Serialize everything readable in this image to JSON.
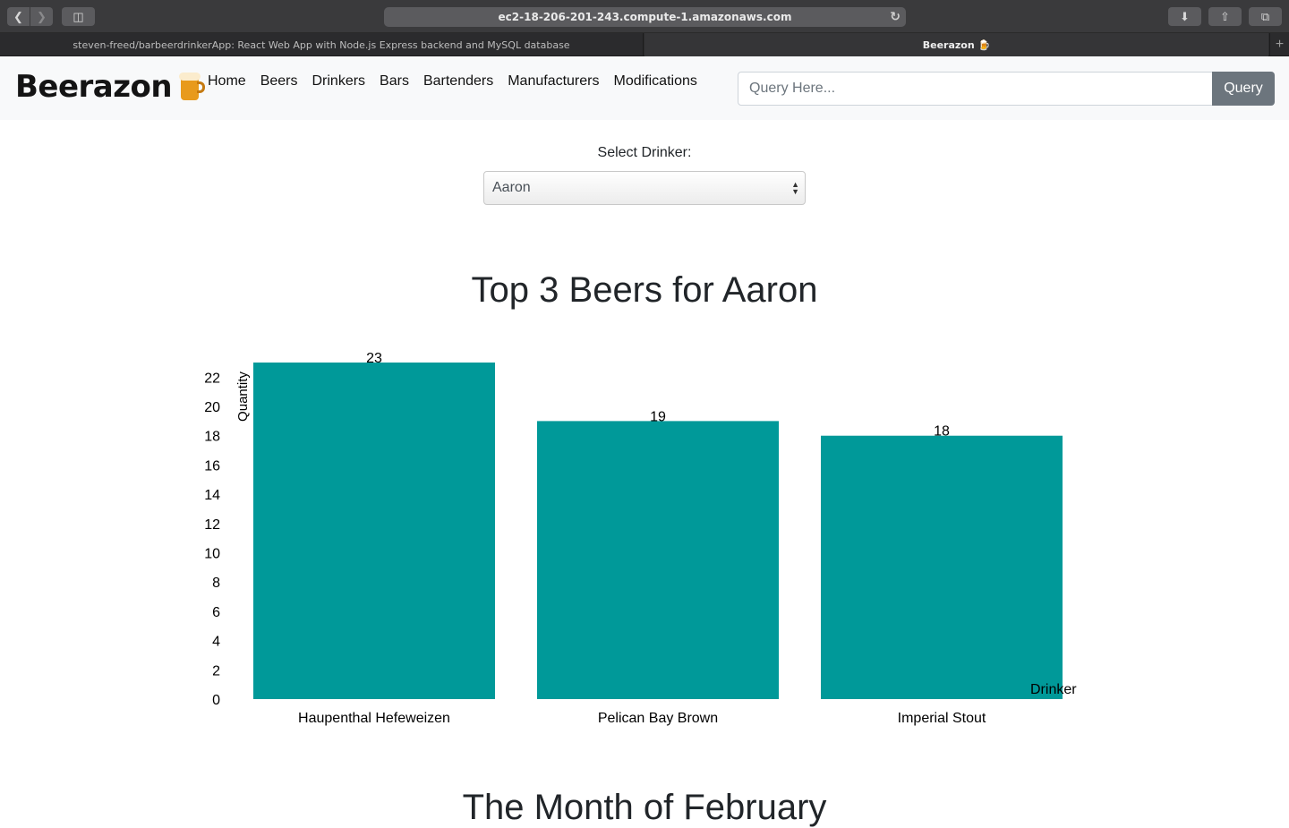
{
  "browser": {
    "url": "ec2-18-206-201-243.compute-1.amazonaws.com",
    "tabs": [
      {
        "label": "steven-freed/barbeerdrinkerApp: React Web App with Node.js Express backend and MySQL database"
      },
      {
        "label": "Beerazon 🍺"
      }
    ]
  },
  "navbar": {
    "brand": "Beerazon",
    "links": [
      "Home",
      "Beers",
      "Drinkers",
      "Bars",
      "Bartenders",
      "Manufacturers",
      "Modifications"
    ],
    "search_placeholder": "Query Here...",
    "query_label": "Query"
  },
  "filter": {
    "label": "Select Drinker:",
    "selected": "Aaron"
  },
  "chart_title": "Top 3 Beers for Aaron",
  "next_section_title": "The Month of February",
  "chart_data": {
    "type": "bar",
    "title": "Top 3 Beers for Aaron",
    "categories": [
      "Haupenthal Hefeweizen",
      "Pelican Bay Brown",
      "Imperial Stout"
    ],
    "values": [
      23,
      19,
      18
    ],
    "ylabel": "Quantity",
    "xlabel": "Drinker",
    "ylim": [
      0,
      23
    ],
    "yticks": [
      0,
      2,
      4,
      6,
      8,
      10,
      12,
      14,
      16,
      18,
      20,
      22
    ],
    "bar_color": "#009999",
    "grid": false
  }
}
